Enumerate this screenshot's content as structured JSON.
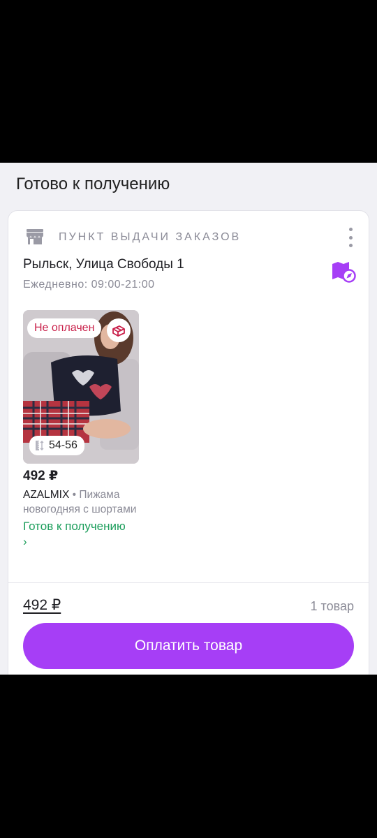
{
  "section": {
    "title": "Готово к получению"
  },
  "pickup": {
    "label": "ПУНКТ ВЫДАЧИ ЗАКАЗОВ",
    "address": "Рыльск, Улица Свободы 1",
    "hours": "Ежедневно: 09:00-21:00"
  },
  "product": {
    "payment_status": "Не оплачен",
    "size": "54-56",
    "price": "492 ₽",
    "brand": "AZALMIX",
    "separator": "•",
    "name_line1": "Пижама",
    "name_line2": "новогодняя с шортами",
    "status": "Готов к получению ›"
  },
  "footer": {
    "total": "492 ₽",
    "count": "1 товар",
    "pay_button": "Оплатить товар"
  },
  "colors": {
    "accent": "#a63ef6",
    "unpaid": "#c9204a",
    "ready": "#1d9e5c",
    "muted": "#8a8a96"
  },
  "icons": [
    "store-icon",
    "more-vertical-icon",
    "map-route-icon",
    "gift-box-icon",
    "size-ruler-icon"
  ]
}
